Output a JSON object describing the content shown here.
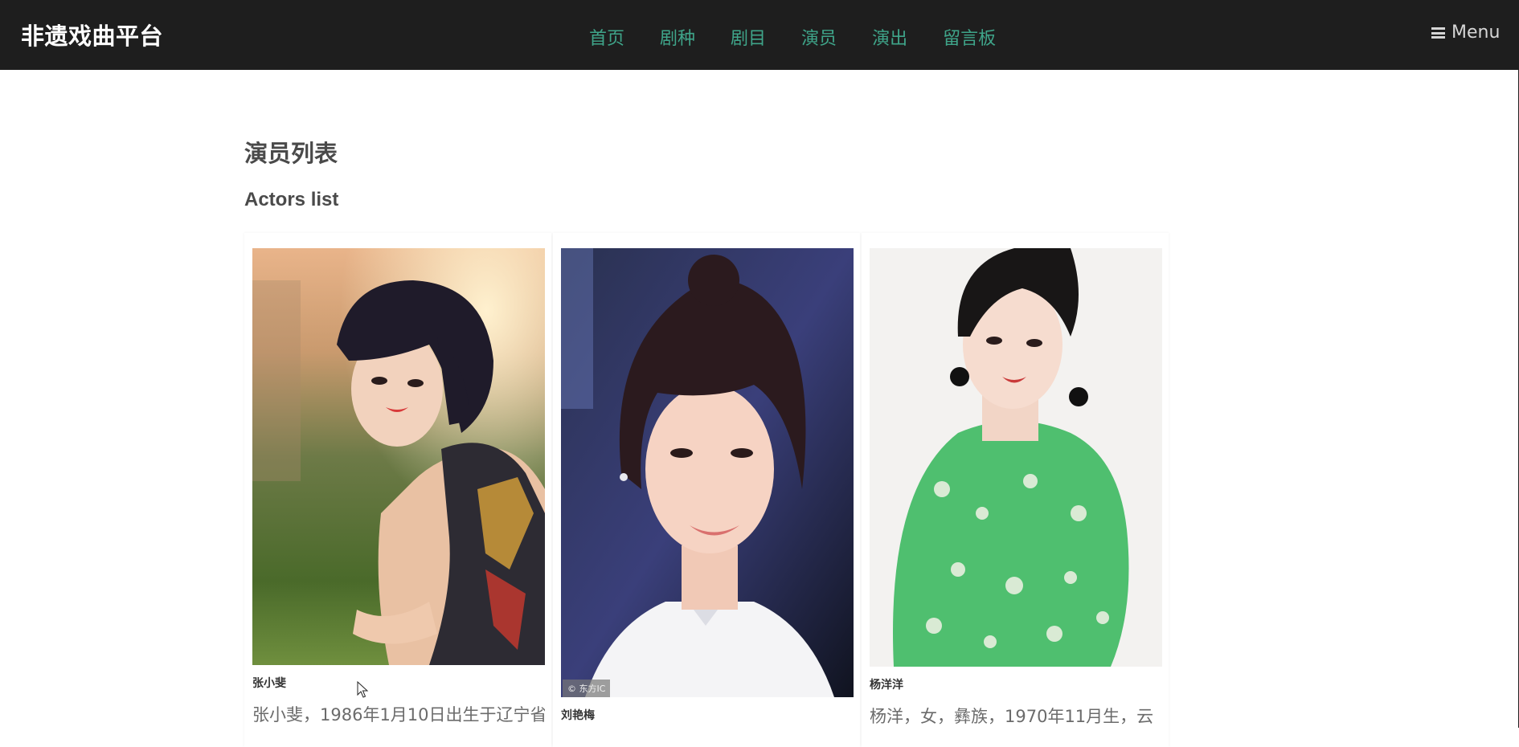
{
  "brand": "非遗戏曲平台",
  "nav": [
    "首页",
    "剧种",
    "剧目",
    "演员",
    "演出",
    "留言板"
  ],
  "menu_label": "Menu",
  "page": {
    "title": "演员列表",
    "subtitle": "Actors list"
  },
  "actors": [
    {
      "name": "张小斐",
      "desc": "张小斐，1986年1月10日出生于辽宁省"
    },
    {
      "name": "刘艳梅",
      "desc": "",
      "watermark": "© 东方IC"
    },
    {
      "name": "杨洋洋",
      "desc": "杨洋，女，彝族，1970年11月生，云"
    }
  ],
  "colors": {
    "navbar_bg": "#1e1e1e",
    "nav_link": "#3fa58a",
    "heading": "#4a4a4a"
  }
}
